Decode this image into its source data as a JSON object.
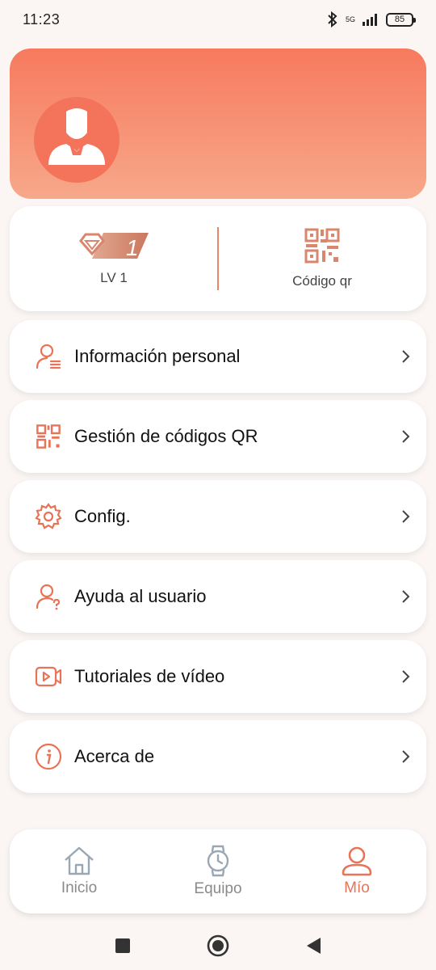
{
  "status_bar": {
    "time": "11:23",
    "network": "5G",
    "battery": "85"
  },
  "level": {
    "badge_number": "1",
    "label": "LV 1"
  },
  "qr": {
    "label": "Código qr"
  },
  "menu": [
    {
      "label": "Información personal",
      "icon": "person-list-icon"
    },
    {
      "label": "Gestión de códigos QR",
      "icon": "qr-code-icon"
    },
    {
      "label": "Config.",
      "icon": "gear-icon"
    },
    {
      "label": "Ayuda al usuario",
      "icon": "user-help-icon"
    },
    {
      "label": "Tutoriales de vídeo",
      "icon": "video-icon"
    },
    {
      "label": "Acerca de",
      "icon": "info-icon"
    }
  ],
  "bottom_nav": {
    "tabs": [
      {
        "label": "Inicio",
        "icon": "home-icon"
      },
      {
        "label": "Equipo",
        "icon": "watch-icon"
      },
      {
        "label": "Mío",
        "icon": "person-icon"
      }
    ],
    "active": "Mío"
  },
  "colors": {
    "accent": "#e87357",
    "header_top": "#f77a5e",
    "header_bottom": "#f7a88a"
  }
}
